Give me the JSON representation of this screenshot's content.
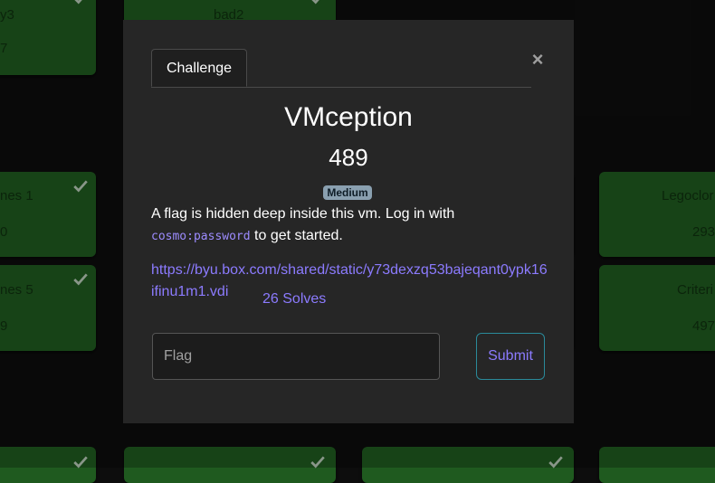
{
  "background_tiles": [
    {
      "name": "y3",
      "value": "7"
    },
    {
      "name": "bad2",
      "value": ""
    },
    {
      "name": "nes 1",
      "value": "0"
    },
    {
      "name": "Legoclor",
      "value": "293"
    },
    {
      "name": "nes 5",
      "value": "9"
    },
    {
      "name": "Criteri",
      "value": "497"
    },
    {
      "name": "",
      "value": ""
    },
    {
      "name": "",
      "value": ""
    },
    {
      "name": "",
      "value": ""
    },
    {
      "name": "",
      "value": ""
    }
  ],
  "modal": {
    "tabs": {
      "challenge": "Challenge",
      "solves": "26 Solves"
    },
    "close_label": "×",
    "title": "VMception",
    "points": "489",
    "difficulty": "Medium",
    "description_before": "A flag is hidden deep inside this vm. Log in with",
    "credentials": "cosmo:password",
    "description_after": " to get started.",
    "link": "https://byu.box.com/shared/static/y73dexzq53bajeqant0ypk16ifinu1m1.vdi",
    "flag_placeholder": "Flag",
    "flag_value": "",
    "submit_label": "Submit"
  },
  "colors": {
    "solved_tile": "#1f5a1f",
    "modal_bg": "#262626",
    "accent_link": "#8c7bff",
    "badge": "#8aa0b0"
  },
  "icons": {
    "tile_check": "check-icon",
    "close": "close-icon"
  }
}
